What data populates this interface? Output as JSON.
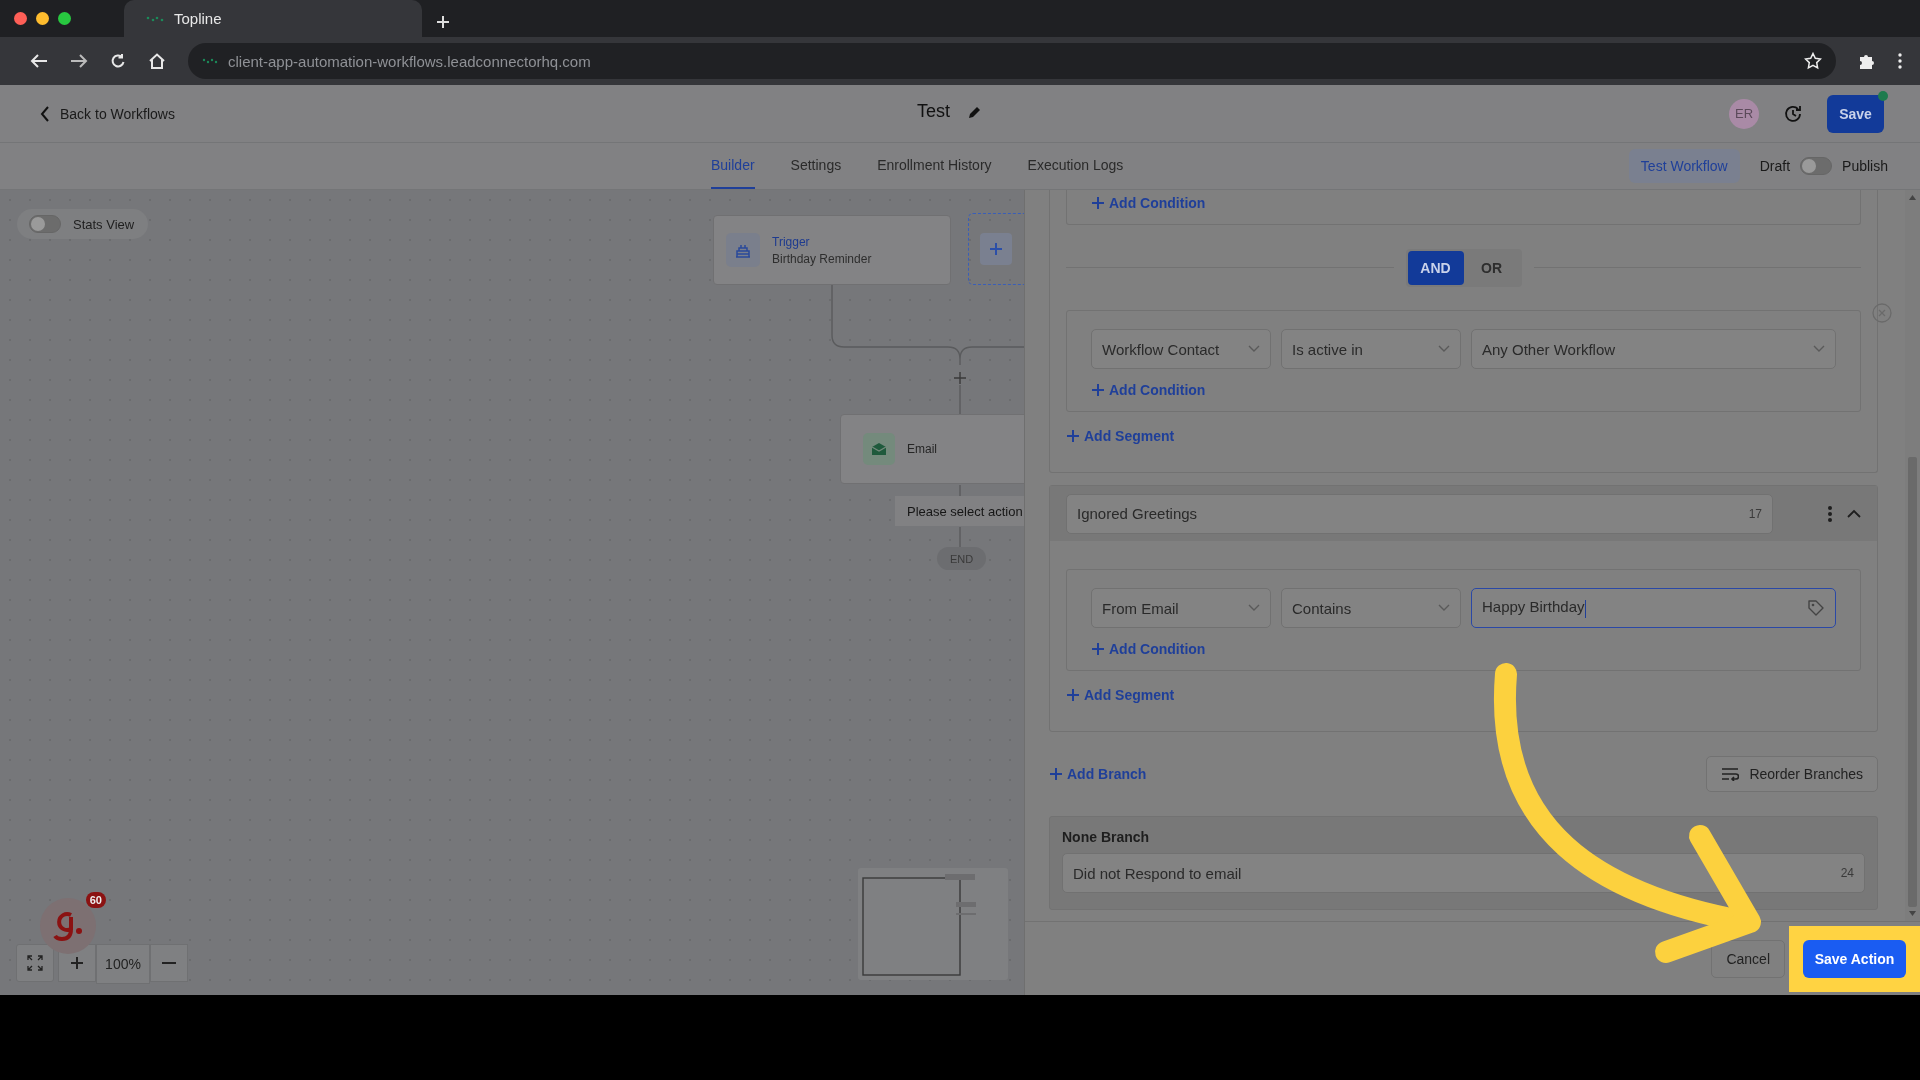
{
  "browser": {
    "tab_title": "Topline",
    "url": "client-app-automation-workflows.leadconnectorhq.com"
  },
  "header": {
    "back_link": "Back to Workflows",
    "title": "Test",
    "avatar": "ER",
    "save_button": "Save"
  },
  "nav": {
    "tabs": [
      {
        "label": "Builder",
        "selected": true
      },
      {
        "label": "Settings",
        "selected": false
      },
      {
        "label": "Enrollment History",
        "selected": false
      },
      {
        "label": "Execution Logs",
        "selected": false
      }
    ],
    "test_button": "Test Workflow",
    "draft_label": "Draft",
    "publish_on": false,
    "publish_label": "Publish"
  },
  "canvas": {
    "stats_view": {
      "label": "Stats View",
      "on": false
    },
    "trigger": {
      "label": "Trigger",
      "subtitle": "Birthday Reminder"
    },
    "email": {
      "label": "Email"
    },
    "action_prompt": "Please select action",
    "end_label": "END",
    "badge": "60",
    "zoom": "100%"
  },
  "panel": {
    "branches": [
      {
        "segments": [
          {
            "add_condition": "Add Condition"
          },
          {
            "conditions": [
              {
                "kind": "select",
                "value": "Workflow Contact",
                "focused": false
              },
              {
                "kind": "select",
                "value": "Is active in",
                "focused": false
              },
              {
                "kind": "select",
                "value": "Any Other Workflow",
                "focused": false
              }
            ],
            "add_condition": "Add Condition"
          }
        ],
        "logic": [
          {
            "label": "AND",
            "selected": true
          },
          {
            "label": "OR",
            "selected": false
          }
        ],
        "add_segment": "Add Segment"
      },
      {
        "name": "Ignored Greetings",
        "count": "17",
        "expanded": true,
        "segments": [
          {
            "conditions": [
              {
                "kind": "select",
                "value": "From Email",
                "focused": false
              },
              {
                "kind": "select",
                "value": "Contains",
                "focused": false
              },
              {
                "kind": "text",
                "value": "Happy Birthday",
                "focused": true
              }
            ],
            "add_condition": "Add Condition"
          }
        ],
        "add_segment": "Add Segment"
      }
    ],
    "add_branch": "Add Branch",
    "reorder_button": "Reorder Branches",
    "none_branch": {
      "title": "None Branch",
      "name": "Did not Respond to email",
      "count": "24"
    },
    "cancel": "Cancel",
    "save_action": "Save Action"
  }
}
